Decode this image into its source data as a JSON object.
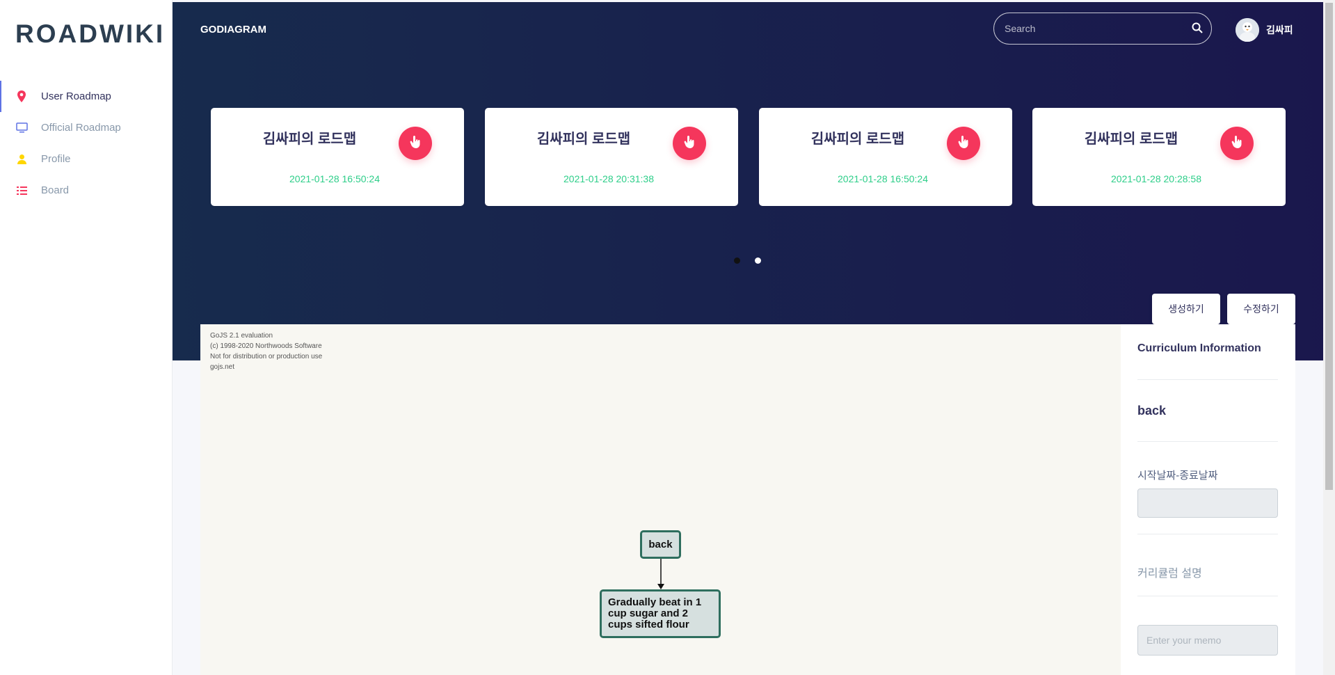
{
  "sidebar": {
    "logo": "ROADWIKI",
    "items": [
      {
        "label": "User Roadmap",
        "icon": "map-pin-icon",
        "color": "#f5365c",
        "active": true
      },
      {
        "label": "Official Roadmap",
        "icon": "monitor-icon",
        "color": "#5e72e4",
        "active": false
      },
      {
        "label": "Profile",
        "icon": "user-icon",
        "color": "#ffd600",
        "active": false
      },
      {
        "label": "Board",
        "icon": "list-icon",
        "color": "#f5365c",
        "active": false
      }
    ]
  },
  "header": {
    "title": "GODIAGRAM",
    "search_placeholder": "Search",
    "user_name": "김싸피"
  },
  "cards": [
    {
      "title": "김싸피의 로드맵",
      "date": "2021-01-28 16:50:24"
    },
    {
      "title": "김싸피의 로드맵",
      "date": "2021-01-28 20:31:38"
    },
    {
      "title": "김싸피의 로드맵",
      "date": "2021-01-28 16:50:24"
    },
    {
      "title": "김싸피의 로드맵",
      "date": "2021-01-28 20:28:58"
    }
  ],
  "carousel": {
    "pages": 2,
    "current": 1
  },
  "actions": {
    "create_label": "생성하기",
    "edit_label": "수정하기"
  },
  "diagram": {
    "watermark": [
      "GoJS 2.1 evaluation",
      "(c) 1998-2020 Northwoods Software",
      "Not for distribution or production use",
      "gojs.net"
    ],
    "nodes": [
      {
        "text": "back"
      },
      {
        "text": "Gradually beat in 1 cup sugar and 2 cups sifted flour"
      }
    ]
  },
  "info": {
    "title": "Curriculum Information",
    "selected": "back",
    "date_label": "시작날짜-종료날짜",
    "description_label": "커리큘럼 설명",
    "memo_placeholder": "Enter your memo"
  },
  "colors": {
    "accent": "#5e72e4",
    "danger": "#f5365c",
    "success": "#2dce89",
    "band": "#172b4d"
  }
}
